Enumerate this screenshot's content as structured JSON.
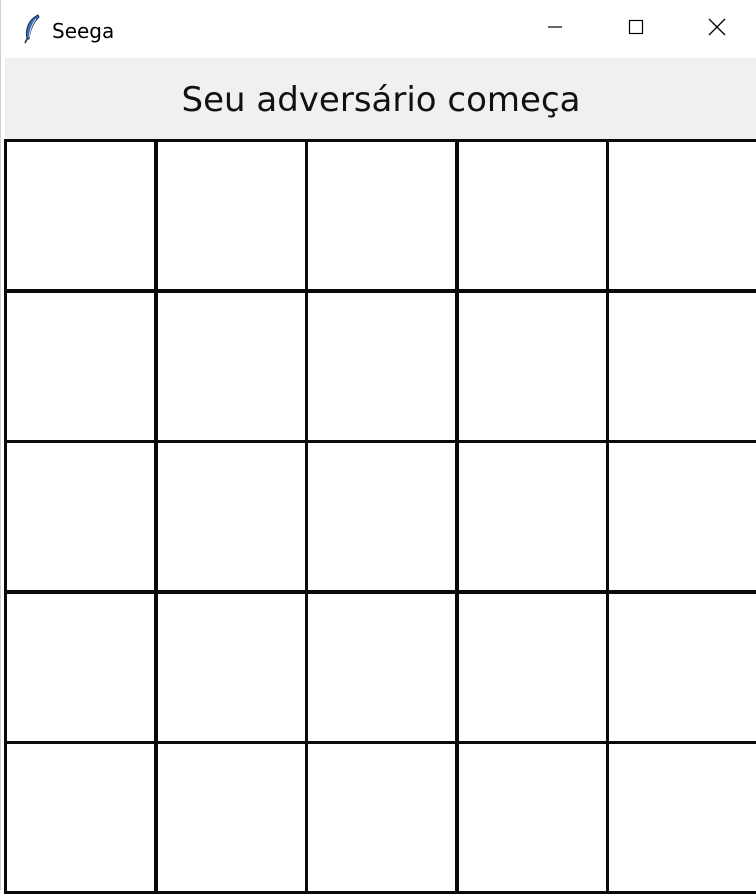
{
  "window": {
    "title": "Seega",
    "app_icon": "feather-icon",
    "controls": {
      "minimize_icon": "minimize-icon",
      "maximize_icon": "maximize-icon",
      "close_icon": "close-icon"
    }
  },
  "header": {
    "status_text": "Seu adversário começa"
  },
  "board": {
    "rows": 5,
    "cols": 5,
    "line_color": "#0a0a0a",
    "cell_color": "#ffffff",
    "header_color": "#f0f0f0"
  }
}
